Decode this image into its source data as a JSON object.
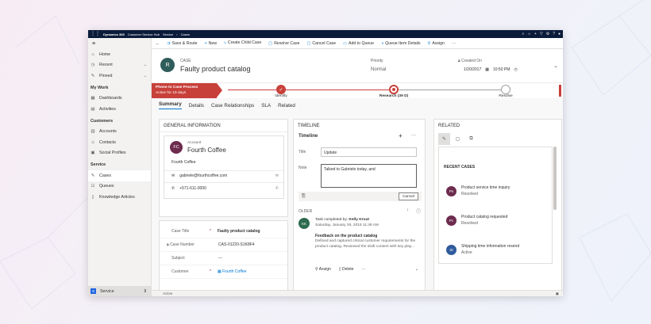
{
  "topbar": {
    "app": "Dynamics 365",
    "hub": "Customer Service Hub",
    "crumb1": "Service",
    "crumb2": "Cases"
  },
  "commands": [
    "Save & Route",
    "New",
    "Create Child Case",
    "Resolve Case",
    "Cancel Case",
    "Add to Queue",
    "Queue Item Details",
    "Assign"
  ],
  "nav": {
    "home": "Home",
    "recent": "Recent",
    "pinned": "Pinned",
    "my_work": "My Work",
    "dashboards": "Dashboards",
    "activities": "Activities",
    "customers": "Customers",
    "accounts": "Accounts",
    "contacts": "Contacts",
    "social": "Social Profiles",
    "service": "Service",
    "cases": "Cases",
    "queues": "Queues",
    "kb": "Knowledge Articles",
    "area_badge": "S",
    "area_label": "Service"
  },
  "header": {
    "type": "CASE",
    "title": "Faulty product catalog",
    "avatar": "R",
    "priority_label": "Priority",
    "priority": "Normal",
    "created_label": "Created On",
    "created_date": "1/20/2017",
    "created_time": "10:50 PM"
  },
  "bpf": {
    "name": "Phone to Case Process",
    "status": "Active for 19 days",
    "stages": [
      "Identify",
      "Research (39 D)",
      "Resolve"
    ]
  },
  "tabs": [
    "Summary",
    "Details",
    "Case Relationships",
    "SLA",
    "Related"
  ],
  "general": {
    "title": "GENERAL INFORMATION",
    "account_label": "Account",
    "account_name": "Fourth Coffee",
    "account_initials": "FC",
    "account_sub": "Fourth Coffee",
    "email": "gabriele@fourthcoffee.com",
    "phone": "+571-611-0000",
    "fields": [
      {
        "label": "Case Title",
        "value": "Faulty product catalog"
      },
      {
        "label": "Case Number",
        "value": "CAS-01220-S1K8F4"
      },
      {
        "label": "Subject",
        "value": "---"
      },
      {
        "label": "Customer",
        "value": "Fourth Coffee"
      }
    ]
  },
  "timeline": {
    "title": "TIMELINE",
    "sub": "Timeline",
    "title_label": "Title",
    "title_value": "Update",
    "note_label": "Note",
    "note_value": "Talked to Gabriele today, and",
    "cancel": "Cancel",
    "add": "Add note",
    "older": "OLDER",
    "entry_initials": "KK",
    "entry_line": "Task completed by:",
    "entry_author": "Kelly Krout",
    "entry_date": "Saturday, January 26, 2019 11:48 AM",
    "entry_title": "Feedback on the product catalog",
    "entry_body": "Defined and captured critical customer requirements for the product catalog. Reviewed the draft content with key play...",
    "assign": "Assign",
    "delete": "Delete"
  },
  "related": {
    "title": "RELATED",
    "recent": "RECENT CASES",
    "cases": [
      {
        "initials": "Ps",
        "title": "Product service time inquiry",
        "status": "Resolved",
        "color": "#6d2b4e"
      },
      {
        "initials": "Pc",
        "title": "Product catalog requested",
        "status": "Resolved",
        "color": "#6d2b4e"
      },
      {
        "initials": "St",
        "title": "Shipping time information resend",
        "status": "Active",
        "color": "#2f5b9c"
      }
    ]
  },
  "status": "Active"
}
